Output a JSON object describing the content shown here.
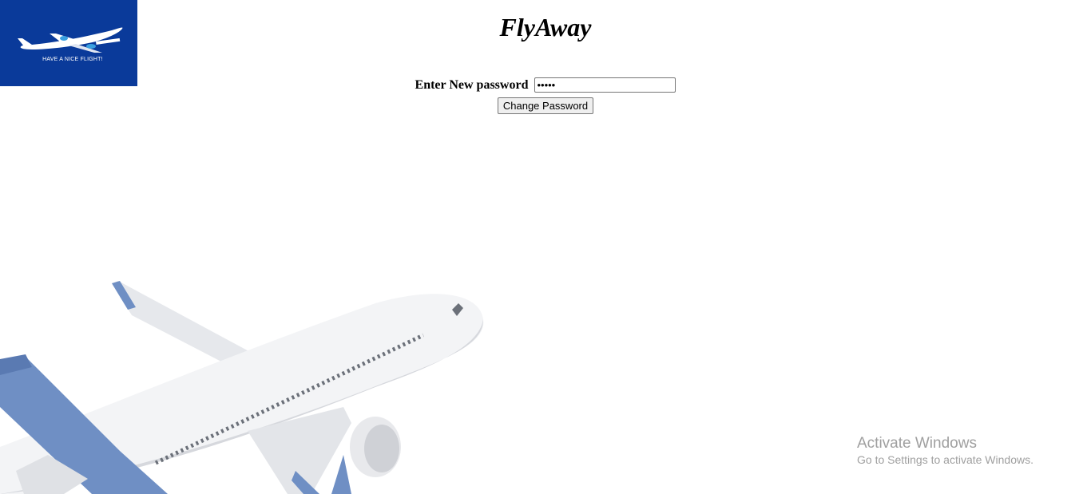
{
  "logo": {
    "tagline": "HAVE A NICE FLIGHT!",
    "icon": "airplane-icon",
    "background_color": "#0a3a9a"
  },
  "header": {
    "title": "FlyAway"
  },
  "form": {
    "password_label": "Enter New password",
    "password_value": "•••••",
    "submit_label": "Change Password"
  },
  "hero": {
    "image": "airplane-illustration",
    "accent_color": "#6f8fc4"
  },
  "watermark": {
    "title": "Activate Windows",
    "subtitle": "Go to Settings to activate Windows."
  }
}
